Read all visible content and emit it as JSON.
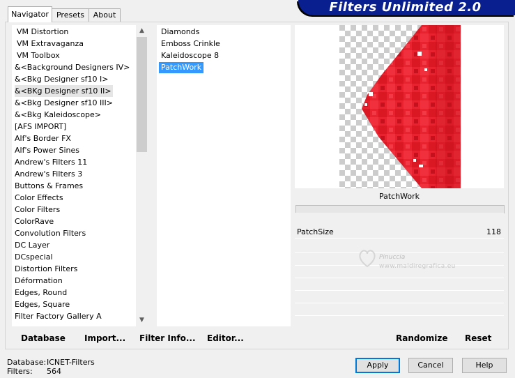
{
  "app": {
    "title": "Filters Unlimited 2.0"
  },
  "tabs": [
    {
      "label": "Navigator",
      "active": true
    },
    {
      "label": "Presets",
      "active": false
    },
    {
      "label": "About",
      "active": false
    }
  ],
  "categories": [
    "VM Distortion",
    "VM Extravaganza",
    "VM Toolbox",
    "&<Background Designers IV>",
    "&<Bkg Designer sf10 I>",
    "&<BKg Designer sf10 II>",
    "&<Bkg Designer sf10 III>",
    "&<Bkg Kaleidoscope>",
    "[AFS IMPORT]",
    "Alf's Border FX",
    "Alf's Power Sines",
    "Andrew's Filters 11",
    "Andrew's Filters 3",
    "Buttons & Frames",
    "Color Effects",
    "Color Filters",
    "ColorRave",
    "Convolution Filters",
    "DC Layer",
    "DCspecial",
    "Distortion Filters",
    "Déformation",
    "Edges, Round",
    "Edges, Square",
    "Filter Factory Gallery A"
  ],
  "selected_category": "&<BKg Designer sf10 II>",
  "filters": [
    "Diamonds",
    "Emboss Crinkle",
    "Kaleidoscope 8",
    "PatchWork"
  ],
  "selected_filter": "PatchWork",
  "preview": {
    "filter_name": "PatchWork",
    "colors": {
      "red": "#e8222f",
      "dark_red": "#c4111d",
      "light_red": "#f23a46"
    }
  },
  "parameters": [
    {
      "label": "PatchSize",
      "value": "118"
    }
  ],
  "watermark": {
    "name": "Pinuccia",
    "url": "www.maldiregrafica.eu"
  },
  "left_buttons": {
    "database": "Database",
    "import": "Import...",
    "filter_info": "Filter Info...",
    "editor": "Editor..."
  },
  "right_buttons": {
    "randomize": "Randomize",
    "reset": "Reset"
  },
  "footer": {
    "database_label": "Database:",
    "database_value": "ICNET-Filters",
    "filters_label": "Filters:",
    "filters_value": "564"
  },
  "dialog_buttons": {
    "apply": "Apply",
    "cancel": "Cancel",
    "help": "Help"
  },
  "colors": {
    "banner": "#0a1f8f",
    "selection": "#3399ff",
    "default_button_border": "#0078d7"
  }
}
